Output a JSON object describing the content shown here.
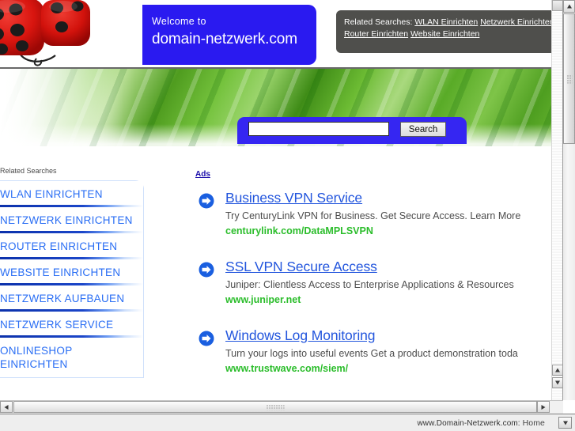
{
  "window": {
    "status_text": "www.Domain-Netzwerk.com:",
    "status_home_label": "Home"
  },
  "banner": {
    "welcome_small": "Welcome to",
    "domain": "domain-netzwerk.com",
    "related": {
      "label": "Related Searches:",
      "links": [
        "WLAN Einrichten",
        "Netzwerk Einrichten",
        "Router Einrichten",
        "Website Einrichten"
      ]
    }
  },
  "search": {
    "value": "",
    "placeholder": "",
    "button_label": "Search"
  },
  "sidebar": {
    "title": "Related Searches",
    "items": [
      {
        "label": "WLAN EINRICHTEN"
      },
      {
        "label": "NETZWERK EINRICHTEN"
      },
      {
        "label": "ROUTER EINRICHTEN"
      },
      {
        "label": "WEBSITE EINRICHTEN"
      },
      {
        "label": "NETZWERK AUFBAUEN"
      },
      {
        "label": "NETZWERK SERVICE"
      },
      {
        "label": "ONLINESHOP EINRICHTEN"
      }
    ]
  },
  "ads": {
    "label": "Ads",
    "items": [
      {
        "title": "Business VPN Service",
        "description": "Try CenturyLink VPN for Business. Get Secure Access. Learn More",
        "url": "centurylink.com/DataMPLSVPN"
      },
      {
        "title": "SSL VPN Secure Access",
        "description": "Juniper: Clientless Access to Enterprise Applications & Resources",
        "url": "www.juniper.net"
      },
      {
        "title": "Windows Log Monitoring",
        "description": "Turn your logs into useful events Get a product demonstration toda",
        "url": "www.trustwave.com/siem/"
      }
    ]
  },
  "colors": {
    "brand_blue": "#2a1af0",
    "search_panel_blue": "#3526f2",
    "link_blue": "#2255dd",
    "url_green": "#2bbd2b",
    "related_box_gray": "#4f4f4c",
    "sidebar_link_blue": "#2a6ef4"
  }
}
